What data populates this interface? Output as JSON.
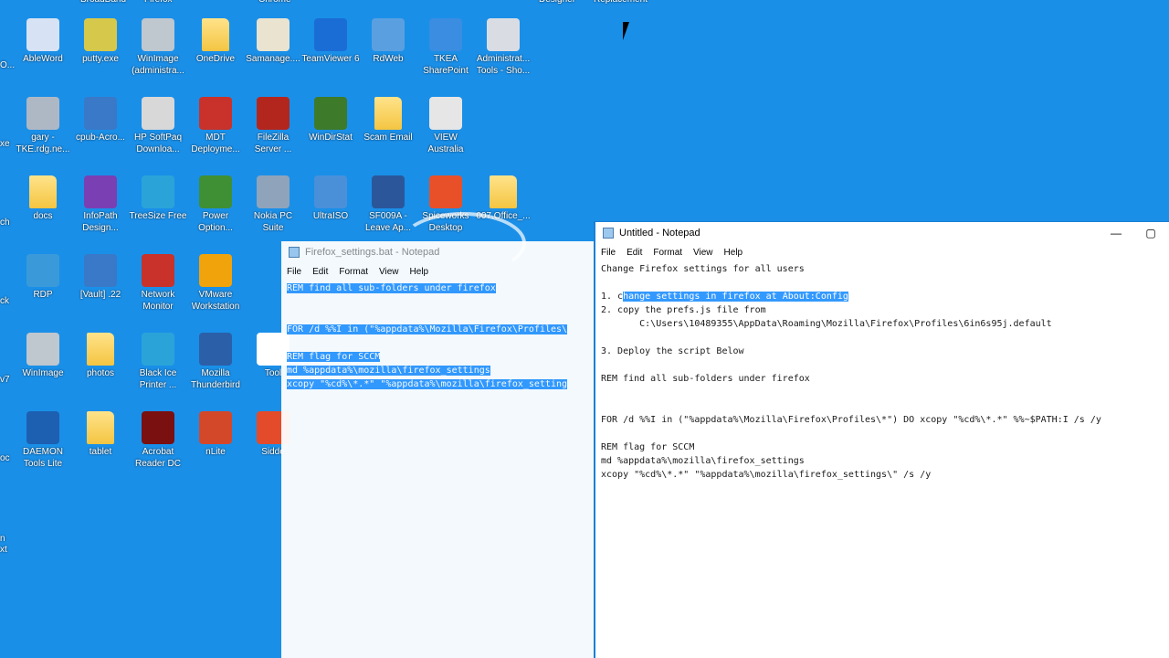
{
  "desktop": {
    "top_labels": [
      "BroadBand",
      "Firefox",
      "Chrome",
      "Designer",
      "Replacement"
    ],
    "icons": [
      {
        "label": "AbleWord",
        "icon": "ableword-icon",
        "color": "#d7e3f4"
      },
      {
        "label": "putty.exe",
        "icon": "putty-icon",
        "color": "#d6c84a"
      },
      {
        "label": "WinImage (administra...",
        "icon": "winimage-icon",
        "color": "#bfc7cf"
      },
      {
        "label": "OneDrive",
        "icon": "folder-icon",
        "color": "#f4c542"
      },
      {
        "label": "Samanage....",
        "icon": "certificate-icon",
        "color": "#e9e3d0"
      },
      {
        "label": "TeamViewer 6",
        "icon": "teamviewer-icon",
        "color": "#1b6dd6"
      },
      {
        "label": "RdWeb",
        "icon": "rdweb-icon",
        "color": "#5aa0e0"
      },
      {
        "label": "TKEA SharePoint",
        "icon": "cloud-icon",
        "color": "#3a8de0"
      },
      {
        "label": "Administrat... Tools - Sho...",
        "icon": "admin-tools-icon",
        "color": "#d9dde3"
      },
      {
        "label": "gary -TKE.rdg.ne...",
        "icon": "network-icon",
        "color": "#aeb8c4"
      },
      {
        "label": "cpub-Acro...",
        "icon": "remote-app-icon",
        "color": "#3a78c8"
      },
      {
        "label": "HP SoftPaq Downloa...",
        "icon": "hp-softpaq-icon",
        "color": "#d8d8d8"
      },
      {
        "label": "MDT Deployme...",
        "icon": "toolbox-icon",
        "color": "#c8322a"
      },
      {
        "label": "FileZilla Server ...",
        "icon": "filezilla-icon",
        "color": "#b3261e"
      },
      {
        "label": "WinDirStat",
        "icon": "tree-icon",
        "color": "#3d7a2a"
      },
      {
        "label": "Scam Email",
        "icon": "folder-icon",
        "color": "#f4c542"
      },
      {
        "label": "VIEW Australia",
        "icon": "view-icon",
        "color": "#e6e6e6"
      },
      {
        "label": "docs",
        "icon": "folder-icon",
        "color": "#f4c542"
      },
      {
        "label": "InfoPath Design...",
        "icon": "infopath-icon",
        "color": "#7b3fb4"
      },
      {
        "label": "TreeSize Free",
        "icon": "treesize-icon",
        "color": "#2aa4d8"
      },
      {
        "label": "Power Option...",
        "icon": "battery-icon",
        "color": "#3f8f35"
      },
      {
        "label": "Nokia PC Suite",
        "icon": "nokia-icon",
        "color": "#8fa4bb"
      },
      {
        "label": "UltraISO",
        "icon": "ultraiso-icon",
        "color": "#4a90d9"
      },
      {
        "label": "SF009A - Leave Ap...",
        "icon": "word-doc-icon",
        "color": "#2b579a"
      },
      {
        "label": "Spiceworks Desktop",
        "icon": "spiceworks-icon",
        "color": "#e8502a"
      },
      {
        "label": "007.Office_...",
        "icon": "folder-icon",
        "color": "#f4c542"
      },
      {
        "label": "RDP",
        "icon": "globe-icon",
        "color": "#3a9ad9"
      },
      {
        "label": "[Vault] .22",
        "icon": "remote-app-icon",
        "color": "#3a78c8"
      },
      {
        "label": "Network Monitor",
        "icon": "network-monitor-icon",
        "color": "#c8322a"
      },
      {
        "label": "VMware Workstation",
        "icon": "vmware-icon",
        "color": "#f0a30a"
      },
      {
        "label": "WinImage",
        "icon": "winimage-icon",
        "color": "#bfc7cf"
      },
      {
        "label": "photos",
        "icon": "folder-icon",
        "color": "#f4c542"
      },
      {
        "label": "Black Ice Printer ...",
        "icon": "island-icon",
        "color": "#2aa4d8"
      },
      {
        "label": "Mozilla Thunderbird",
        "icon": "thunderbird-icon",
        "color": "#2b5fa8"
      },
      {
        "label": "Tool",
        "icon": "document-icon",
        "color": "#ffffff"
      },
      {
        "label": "DAEMON Tools Lite",
        "icon": "daemon-tools-icon",
        "color": "#1d5fb0"
      },
      {
        "label": "tablet",
        "icon": "folder-icon",
        "color": "#f4c542"
      },
      {
        "label": "Acrobat Reader DC",
        "icon": "acrobat-icon",
        "color": "#7a1010"
      },
      {
        "label": "nLite",
        "icon": "nlite-icon",
        "color": "#d4482a"
      },
      {
        "label": "Sidde",
        "icon": "sidde-icon",
        "color": "#e34b2a"
      }
    ],
    "left_edge_labels": [
      "O...",
      "xe",
      "ch",
      "ck",
      "v7",
      "oc",
      "n",
      "xt"
    ]
  },
  "notepad_back": {
    "title": "Firefox_settings.bat - Notepad",
    "menu": [
      "File",
      "Edit",
      "Format",
      "View",
      "Help"
    ],
    "lines": [
      "REM find all sub-folders under firefox",
      "",
      "",
      "FOR /d %%I in (\"%appdata%\\Mozilla\\Firefox\\Profiles\\",
      "",
      "REM flag for SCCM",
      "md %appdata%\\mozilla\\firefox_settings",
      "xcopy \"%cd%\\*.*\" \"%appdata%\\mozilla\\firefox_setting"
    ]
  },
  "notepad_front": {
    "title": "Untitled - Notepad",
    "menu": [
      "File",
      "Edit",
      "Format",
      "View",
      "Help"
    ],
    "minimize": "—",
    "maximize": "▢",
    "lines": [
      "Change Firefox settings for all users",
      "",
      "1. change settings in firefox at About:Config",
      "2. copy the prefs.js file from",
      "       C:\\Users\\10489355\\AppData\\Roaming\\Mozilla\\Firefox\\Profiles\\6in6s95j.default",
      "",
      "3. Deploy the script Below",
      "",
      "REM find all sub-folders under firefox",
      "",
      "",
      "FOR /d %%I in (\"%appdata%\\Mozilla\\Firefox\\Profiles\\*\") DO xcopy \"%cd%\\*.*\" %%~$PATH:I /s /y",
      "",
      "REM flag for SCCM",
      "md %appdata%\\mozilla\\firefox_settings",
      "xcopy \"%cd%\\*.*\" \"%appdata%\\mozilla\\firefox_settings\\\" /s /y"
    ],
    "selection_line": 2,
    "selection_prefix": "1. c",
    "selection_text": "hange settings in firefox at About:Config"
  }
}
